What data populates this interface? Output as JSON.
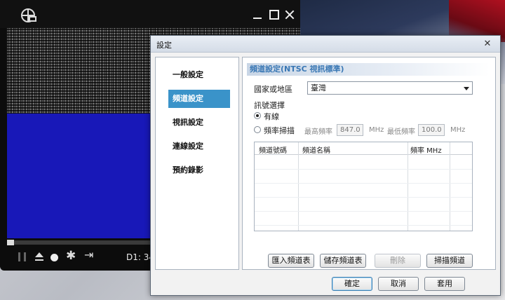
{
  "player": {
    "time_label": "D1: 34"
  },
  "dialog": {
    "title": "設定",
    "close_glyph": "✕",
    "nav": {
      "items": [
        {
          "label": "一般設定",
          "selected": false
        },
        {
          "label": "頻道設定",
          "selected": true
        },
        {
          "label": "視訊設定",
          "selected": false
        },
        {
          "label": "連線設定",
          "selected": false
        },
        {
          "label": "預約錄影",
          "selected": false
        }
      ]
    },
    "channel_panel": {
      "section_title": "頻道設定(NTSC 視訊標準)",
      "country_label": "國家或地區",
      "country_value": "臺灣",
      "signal_label": "訊號選擇",
      "radio_cable": "有線",
      "radio_freq_scan": "頻率掃描",
      "max_freq_label": "最高頻率",
      "max_freq_value": "847.0",
      "max_freq_unit": "MHz",
      "min_freq_label": "最低頻率",
      "min_freq_value": "100.0",
      "min_freq_unit": "MHz",
      "table": {
        "columns": [
          "頻道號碼",
          "頻道名稱",
          "頻率 MHz"
        ],
        "rows": []
      },
      "buttons": {
        "import": "匯入頻道表",
        "save": "儲存頻道表",
        "delete": "刪除",
        "scan": "掃描頻道"
      }
    },
    "footer": {
      "ok": "確定",
      "cancel": "取消",
      "apply": "套用"
    }
  }
}
